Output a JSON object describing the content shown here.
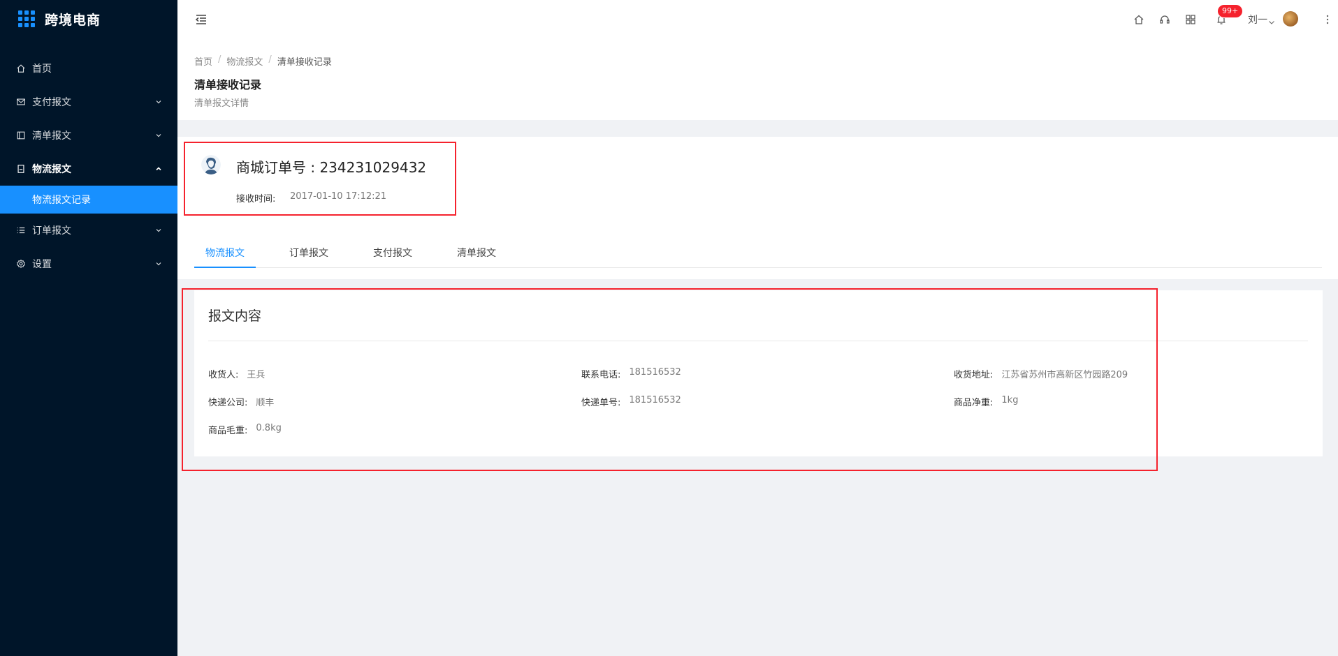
{
  "app": {
    "title": "跨境电商"
  },
  "sidebar": {
    "items": [
      {
        "label": "首页",
        "icon": "home-icon"
      },
      {
        "label": "支付报文",
        "icon": "mail-icon"
      },
      {
        "label": "清单报文",
        "icon": "layout-icon"
      },
      {
        "label": "物流报文",
        "icon": "container-icon",
        "open": true
      },
      {
        "label": "订单报文",
        "icon": "list-icon"
      },
      {
        "label": "设置",
        "icon": "gear-icon"
      }
    ],
    "active_sub": "物流报文记录"
  },
  "header": {
    "notification_count": "99+",
    "user_name": "刘一",
    "icons": [
      "home-icon",
      "headset-icon",
      "apps-icon",
      "bell-icon"
    ]
  },
  "breadcrumb": [
    "首页",
    "物流报文",
    "清单接收记录"
  ],
  "page": {
    "title": "清单接收记录",
    "description": "清单报文详情"
  },
  "order": {
    "number_text": "商城订单号 : 234231029432",
    "received_label": "接收时间:",
    "received_value": "2017-01-10 17:12:21"
  },
  "tabs": [
    "物流报文",
    "订单报文",
    "支付报文",
    "清单报文"
  ],
  "content": {
    "title": "报文内容",
    "fields": {
      "receiver": {
        "label": "收货人:",
        "value": "王兵"
      },
      "phone": {
        "label": "联系电话:",
        "value": "181516532"
      },
      "address": {
        "label": "收货地址:",
        "value": "江苏省苏州市高新区竹园路209"
      },
      "courier": {
        "label": "快递公司:",
        "value": "顺丰"
      },
      "tracking": {
        "label": "快递单号:",
        "value": "181516532"
      },
      "net_weight": {
        "label": "商品净重:",
        "value": "1kg"
      },
      "gross_weight": {
        "label": "商品毛重:",
        "value": "0.8kg"
      }
    }
  },
  "colors": {
    "sidebar_bg": "#001529",
    "accent": "#1890ff",
    "highlight": "#f5222d",
    "badge": "#f5222d"
  }
}
